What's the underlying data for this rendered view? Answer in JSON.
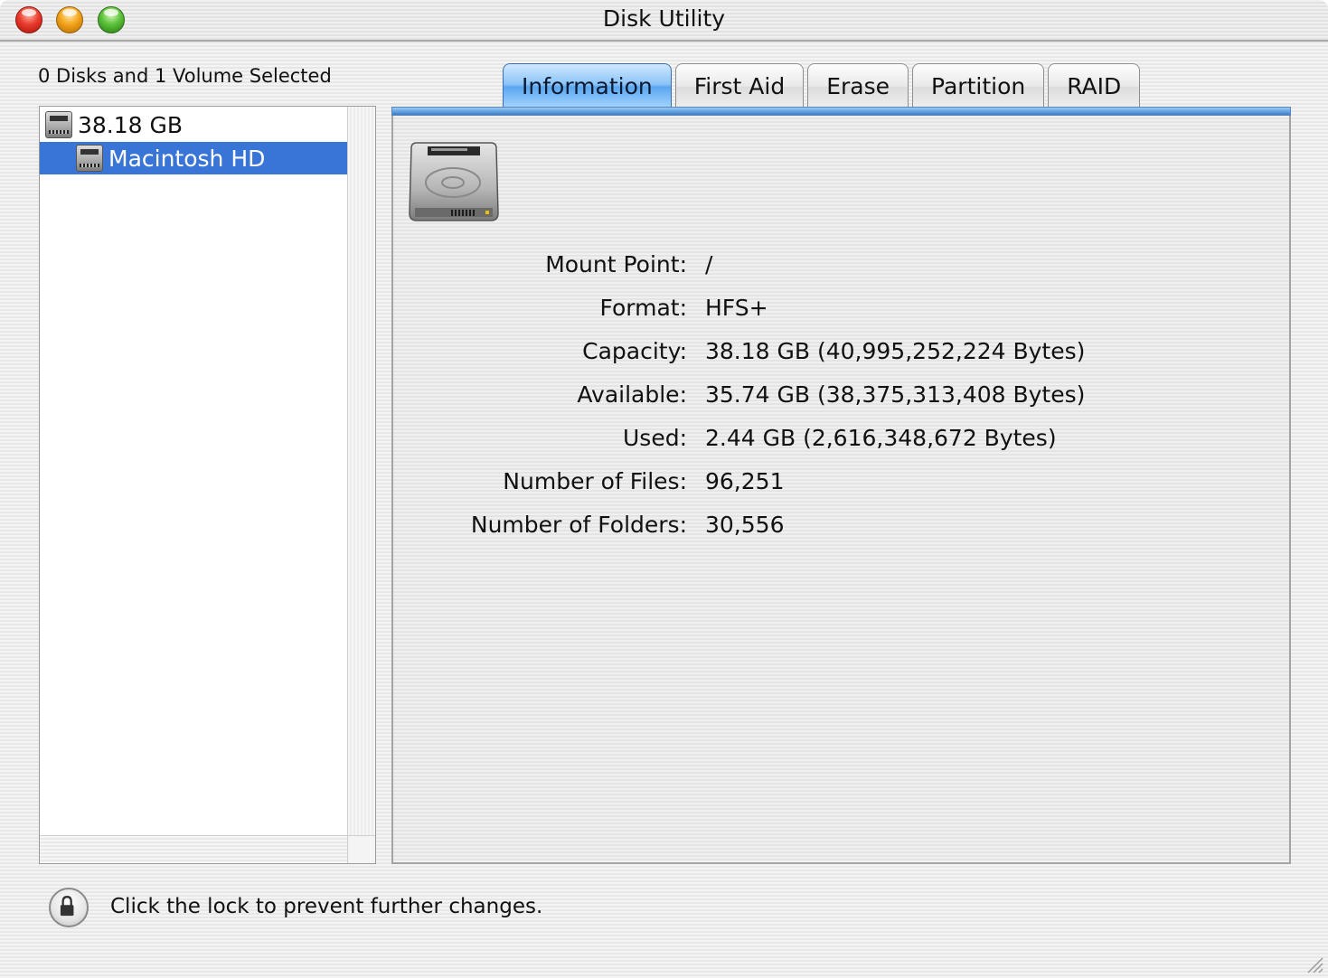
{
  "window": {
    "title": "Disk Utility"
  },
  "sidebar": {
    "selection_summary": "0 Disks and 1 Volume Selected",
    "items": [
      {
        "label": "38.18 GB",
        "icon": "hard-disk-icon",
        "selected": false
      },
      {
        "label": "Macintosh HD",
        "icon": "volume-icon",
        "selected": true
      }
    ]
  },
  "tabs": [
    {
      "label": "Information",
      "active": true
    },
    {
      "label": "First Aid",
      "active": false
    },
    {
      "label": "Erase",
      "active": false
    },
    {
      "label": "Partition",
      "active": false
    },
    {
      "label": "RAID",
      "active": false
    }
  ],
  "info": {
    "icon": "hard-drive-icon",
    "rows": [
      {
        "label": "Mount Point:",
        "value": "/"
      },
      {
        "label": "Format:",
        "value": "HFS+"
      },
      {
        "label": "Capacity:",
        "value": "38.18 GB (40,995,252,224 Bytes)"
      },
      {
        "label": "Available:",
        "value": "35.74 GB (38,375,313,408 Bytes)"
      },
      {
        "label": "Used:",
        "value": "2.44 GB (2,616,348,672 Bytes)"
      },
      {
        "label": "Number of Files:",
        "value": "96,251"
      },
      {
        "label": "Number of Folders:",
        "value": "30,556"
      }
    ]
  },
  "footer": {
    "lock_text": "Click the lock to prevent further changes.",
    "lock_icon": "lock-icon"
  },
  "colors": {
    "selection": "#3875d7",
    "active_tab": "#5aa7ef"
  }
}
